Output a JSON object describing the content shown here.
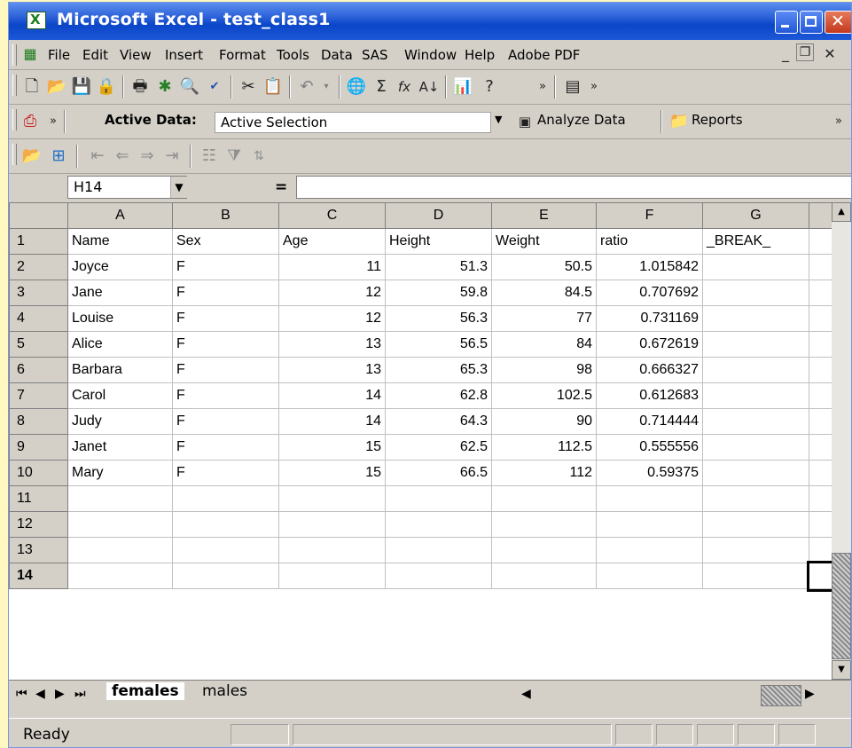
{
  "window": {
    "title": "Microsoft Excel - test_class1"
  },
  "menu": {
    "items": [
      "File",
      "Edit",
      "View",
      "Insert",
      "Format",
      "Tools",
      "Data",
      "SAS",
      "Window",
      "Help",
      "Adobe PDF"
    ]
  },
  "sas_toolbar": {
    "active_data_label": "Active Data:",
    "active_data_value": "Active Selection",
    "analyze_label": "Analyze Data",
    "reports_label": "Reports"
  },
  "formula_bar": {
    "name_box": "H14",
    "equals": "=",
    "content": ""
  },
  "sheet": {
    "columns": [
      "A",
      "B",
      "C",
      "D",
      "E",
      "F",
      "G"
    ],
    "header_row": [
      "Name",
      "Sex",
      "Age",
      "Height",
      "Weight",
      "ratio",
      "_BREAK_"
    ],
    "rows": [
      [
        "Joyce",
        "F",
        "11",
        "51.3",
        "50.5",
        "1.015842"
      ],
      [
        "Jane",
        "F",
        "12",
        "59.8",
        "84.5",
        "0.707692"
      ],
      [
        "Louise",
        "F",
        "12",
        "56.3",
        "77",
        "0.731169"
      ],
      [
        "Alice",
        "F",
        "13",
        "56.5",
        "84",
        "0.672619"
      ],
      [
        "Barbara",
        "F",
        "13",
        "65.3",
        "98",
        "0.666327"
      ],
      [
        "Carol",
        "F",
        "14",
        "62.8",
        "102.5",
        "0.612683"
      ],
      [
        "Judy",
        "F",
        "14",
        "64.3",
        "90",
        "0.714444"
      ],
      [
        "Janet",
        "F",
        "15",
        "62.5",
        "112.5",
        "0.555556"
      ],
      [
        "Mary",
        "F",
        "15",
        "66.5",
        "112",
        "0.59375"
      ]
    ],
    "empty_rows": [
      "11",
      "12",
      "13",
      "14"
    ],
    "active_row": "14",
    "row_numbers": [
      "1",
      "2",
      "3",
      "4",
      "5",
      "6",
      "7",
      "8",
      "9",
      "10"
    ]
  },
  "tabs": [
    "females",
    "males"
  ],
  "active_tab": "females",
  "status": {
    "text": "Ready"
  }
}
